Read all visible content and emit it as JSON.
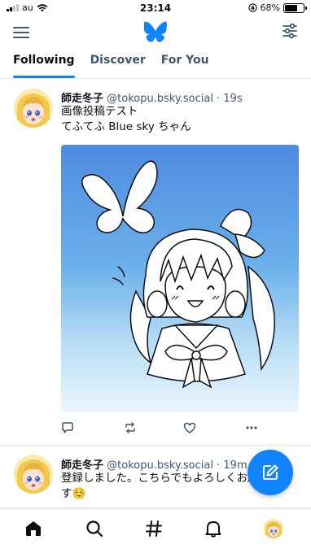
{
  "status_bar": {
    "carrier": "au",
    "time": "23:14",
    "battery": "68%",
    "battery_level": 0.68
  },
  "header": {
    "menu_icon": "hamburger-menu-icon",
    "logo_icon": "butterfly-logo-icon",
    "settings_icon": "feed-settings-icon"
  },
  "tabs": [
    {
      "label": "Following",
      "active": true
    },
    {
      "label": "Discover",
      "active": false
    },
    {
      "label": "For You",
      "active": false
    }
  ],
  "posts": [
    {
      "author_name": "師走冬子",
      "handle": "@tokopu.bsky.social",
      "separator": "·",
      "time": "19s",
      "text_line_1": "画像投稿テスト",
      "text_line_2": "てふてふ Blue sky ちゃん",
      "has_image": true,
      "actions": [
        "reply-icon",
        "repost-icon",
        "like-icon",
        "more-icon"
      ]
    },
    {
      "author_name": "師走冬子",
      "handle": "@tokopu.bsky.social",
      "separator": "·",
      "time": "19m",
      "text": "登録しました。こちらでもよろしくお願いします☺️"
    }
  ],
  "fab": {
    "icon": "compose-icon"
  },
  "bottom_nav": [
    "home-icon",
    "search-icon",
    "hashtag-icon",
    "notifications-icon",
    "profile-avatar"
  ],
  "colors": {
    "accent": "#1083fe",
    "text": "#0b0f14",
    "muted": "#42576c",
    "divider": "#e3e8ed"
  }
}
